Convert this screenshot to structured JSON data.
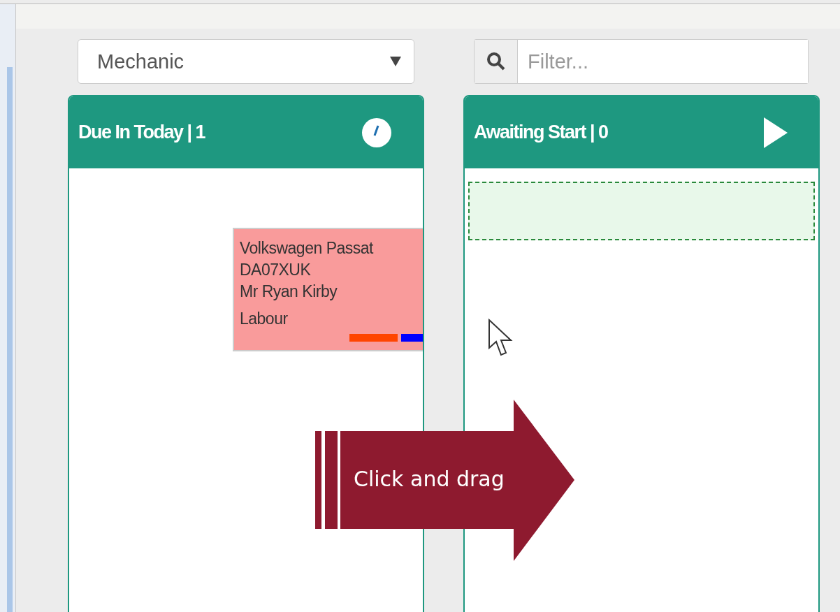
{
  "filters": {
    "mechanic_select": {
      "value": "Mechanic"
    },
    "search": {
      "placeholder": "Filter..."
    }
  },
  "columns": [
    {
      "title": "Due In Today | 1",
      "kind": "clock",
      "drop_target": false,
      "cards": [
        {
          "vehicle": "Volkswagen Passat",
          "registration": "DA07XUK",
          "customer": "Mr Ryan Kirby",
          "job_type": "Labour",
          "tags": [
            {
              "color": "#ff4500"
            },
            {
              "color": "#0000ff"
            }
          ]
        }
      ]
    },
    {
      "title": "Awaiting Start | 0",
      "kind": "play",
      "drop_target": true
    }
  ],
  "callout": {
    "text": "Click and drag"
  }
}
